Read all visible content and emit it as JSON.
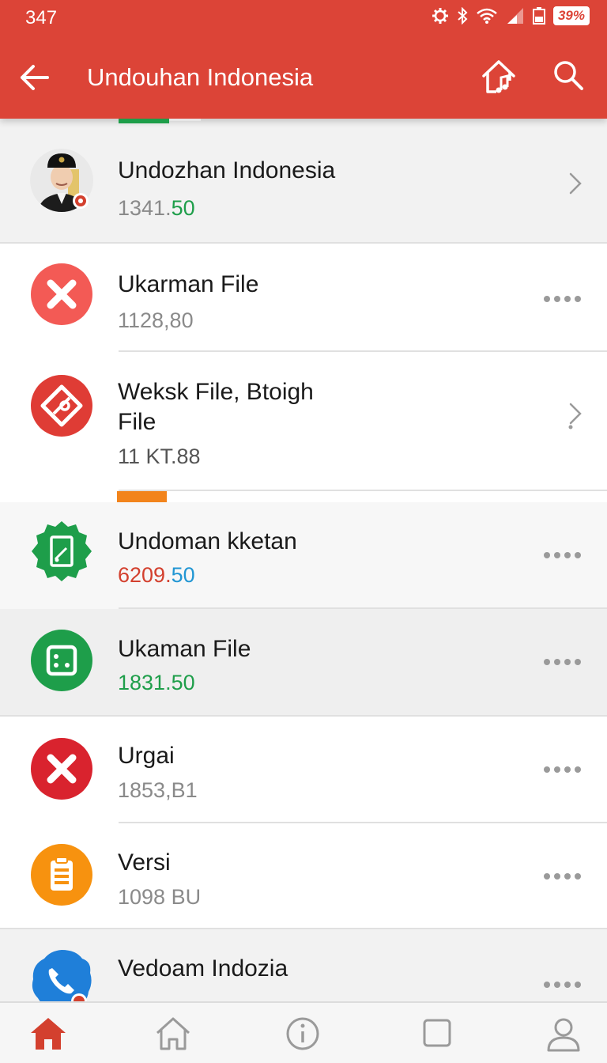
{
  "status_bar": {
    "time": "347",
    "battery": "39%",
    "icons": [
      "settings-gear-icon",
      "bluetooth-icon",
      "wifi-icon",
      "signal-icon",
      "battery-icon"
    ]
  },
  "toolbar": {
    "title": "Undouhan Indonesia",
    "back_icon": "arrow-left-icon",
    "home_icon": "home-music-icon",
    "search_icon": "search-icon"
  },
  "list": [
    {
      "title": "Undozhan Indonesia",
      "sub_main": "1341.",
      "sub_accent": "50",
      "trailing": "chevron"
    },
    {
      "title": "Ukarman File",
      "sub": "1128,80",
      "trailing": "more"
    },
    {
      "title": "Weksk File, Btoigh",
      "title2": "File",
      "sub": "11 KT.88",
      "trailing": "chevron"
    },
    {
      "title": "Undoman kketan",
      "sub_main": "6209.",
      "sub_accent": "50",
      "trailing": "more"
    },
    {
      "title": "Ukaman File",
      "sub": "1831.50",
      "trailing": "more"
    },
    {
      "title": "Urgai",
      "sub": "1853,B1",
      "trailing": "more"
    },
    {
      "title": "Versi",
      "sub": "1098 BU",
      "trailing": "more"
    },
    {
      "title": "Vedoam Indozia",
      "trailing": "more"
    }
  ],
  "colors": {
    "appbar": "#dc4437",
    "accent_green": "#1e9e4a",
    "accent_red": "#d3402e",
    "accent_blue": "#2196d3",
    "accent_orange": "#f2841c"
  },
  "bottom_nav": [
    "home-filled-icon",
    "home-outline-icon",
    "info-icon",
    "square-icon",
    "profile-icon"
  ]
}
